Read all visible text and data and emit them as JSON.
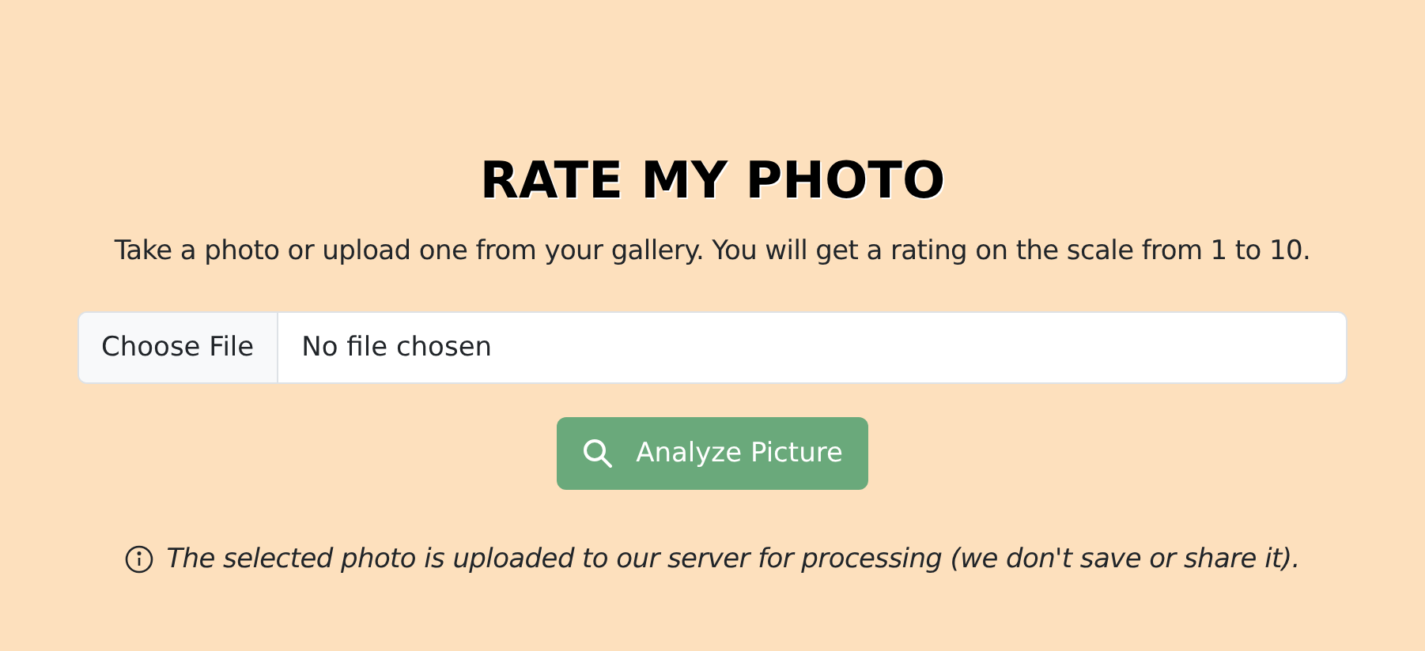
{
  "title": "RATE MY PHOTO",
  "subtitle": "Take a photo or upload one from your gallery. You will get a rating on the scale from 1 to 10.",
  "file_input": {
    "button": "Choose File",
    "value": "No file chosen"
  },
  "analyze_button": {
    "label": "Analyze Picture"
  },
  "note": "The selected photo is uploaded to our server for processing (we don't save or share it)."
}
